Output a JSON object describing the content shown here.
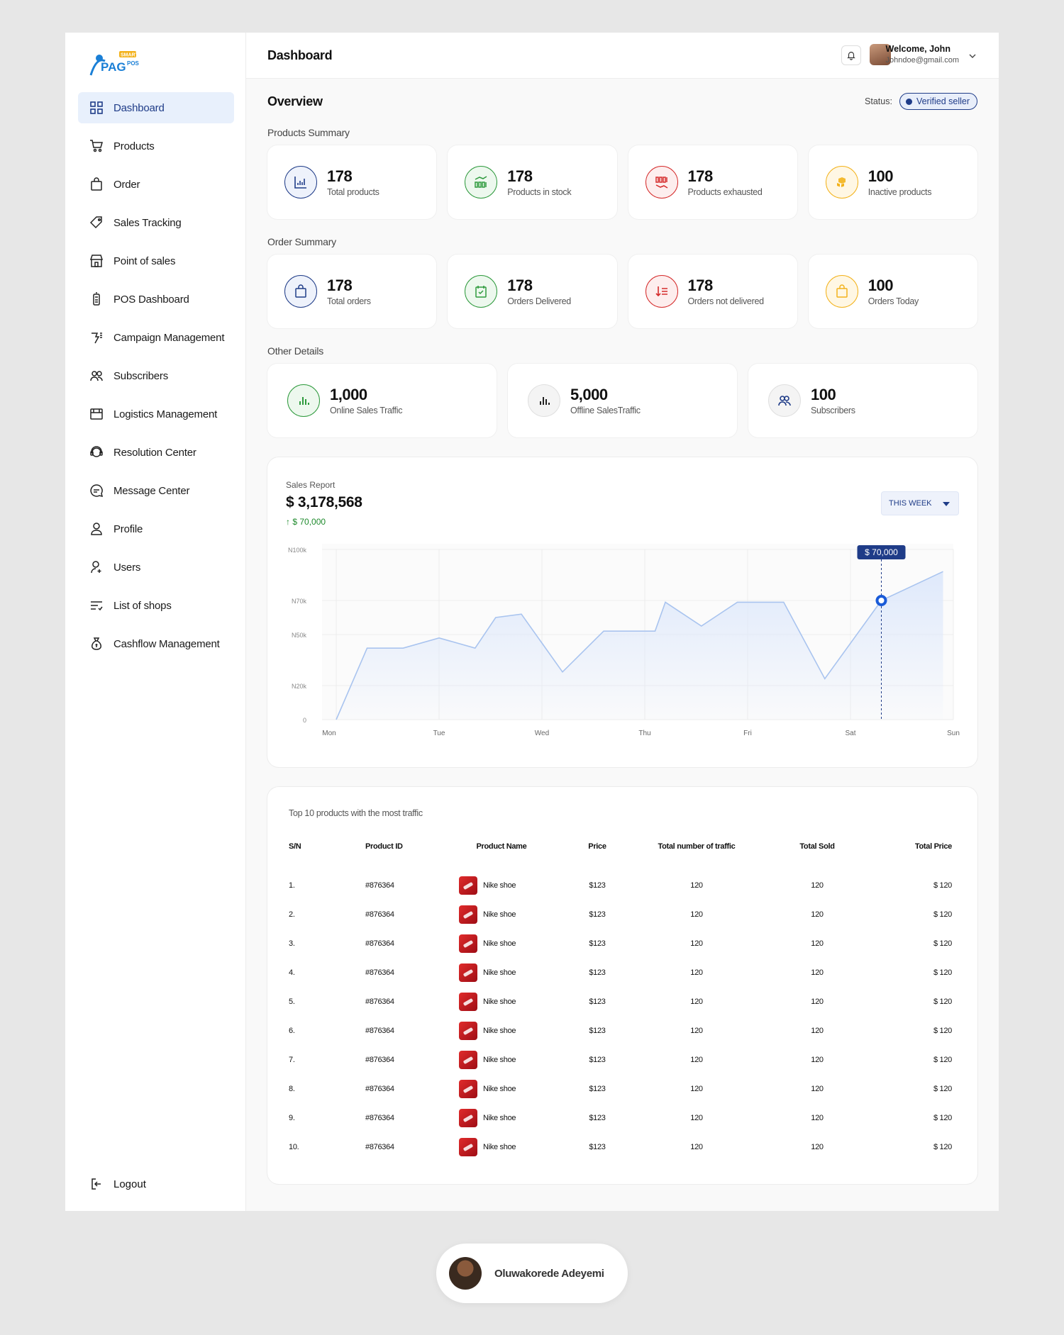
{
  "brand": {
    "logo_text": "PAG",
    "logo_badge": "SMART",
    "logo_sub": "POS"
  },
  "sidebar": {
    "items": [
      {
        "label": "Dashboard",
        "icon": "grid-icon",
        "active": true
      },
      {
        "label": "Products",
        "icon": "cart-icon"
      },
      {
        "label": "Order",
        "icon": "bag-icon"
      },
      {
        "label": "Sales Tracking",
        "icon": "tag-icon"
      },
      {
        "label": "Point of sales",
        "icon": "store-icon"
      },
      {
        "label": "POS Dashboard",
        "icon": "pos-terminal-icon"
      },
      {
        "label": "Campaign Management",
        "icon": "megaphone-icon"
      },
      {
        "label": "Subscribers",
        "icon": "people-icon"
      },
      {
        "label": "Logistics Management",
        "icon": "truck-icon"
      },
      {
        "label": "Resolution Center",
        "icon": "headset-icon"
      },
      {
        "label": "Message Center",
        "icon": "chat-icon"
      },
      {
        "label": "Profile",
        "icon": "user-icon"
      },
      {
        "label": "Users",
        "icon": "user-add-icon"
      },
      {
        "label": "List of shops",
        "icon": "list-icon"
      },
      {
        "label": "Cashflow Management",
        "icon": "money-bag-icon"
      }
    ],
    "logout": "Logout"
  },
  "header": {
    "title": "Dashboard",
    "welcome": "Welcome, John",
    "email": "Johndoe@gmail.com"
  },
  "overview": {
    "title": "Overview",
    "status_label": "Status:",
    "status_value": "Verified seller"
  },
  "products_summary": {
    "title": "Products Summary",
    "cards": [
      {
        "value": "178",
        "label": "Total products",
        "color": "#1f3c88",
        "icon": "bar-chart-icon"
      },
      {
        "value": "178",
        "label": "Products in stock",
        "color": "#2e9a3d",
        "icon": "stock-chart-icon"
      },
      {
        "value": "178",
        "label": "Products exhausted",
        "color": "#d52b2b",
        "icon": "decline-chart-icon"
      },
      {
        "value": "100",
        "label": "Inactive products",
        "color": "#f3b21b",
        "icon": "boxes-icon"
      }
    ]
  },
  "order_summary": {
    "title": "Order Summary",
    "cards": [
      {
        "value": "178",
        "label": "Total orders",
        "color": "#1f3c88",
        "icon": "bag-icon"
      },
      {
        "value": "178",
        "label": "Orders Delivered",
        "color": "#2e9a3d",
        "icon": "check-box-icon"
      },
      {
        "value": "178",
        "label": "Orders not delivered",
        "color": "#d52b2b",
        "icon": "sort-down-icon"
      },
      {
        "value": "100",
        "label": "Orders Today",
        "color": "#f3b21b",
        "icon": "bag-icon"
      }
    ]
  },
  "other_details": {
    "title": "Other Details",
    "cards": [
      {
        "value": "1,000",
        "label": "Online Sales Traffic",
        "color": "#2e9a3d",
        "icon": "bar-chart-icon"
      },
      {
        "value": "5,000",
        "label": "Offline SalesTraffic",
        "color": "#222222",
        "icon": "bar-chart-icon"
      },
      {
        "value": "100",
        "label": "Subscribers",
        "color": "#1f3c88",
        "icon": "people-icon"
      }
    ]
  },
  "sales_report": {
    "title": "Sales Report",
    "total": "$ 3,178,568",
    "change": "↑ $ 70,000",
    "period": "THIS WEEK",
    "tooltip": "$ 70,000"
  },
  "chart_data": {
    "type": "area",
    "x_labels": [
      "Mon",
      "Tue",
      "Wed",
      "Thu",
      "Fri",
      "Sat",
      "Sun"
    ],
    "y_ticks": [
      "0",
      "N20k",
      "N50k",
      "N70k",
      "N100k"
    ],
    "ylim": [
      0,
      100
    ],
    "y_tick_values": [
      0,
      20,
      50,
      70,
      100
    ],
    "grid": true,
    "accent_color": "#1a5bd8",
    "fill_color": "#dfe9fb",
    "line_color": "#a9c4ef",
    "points": [
      {
        "x": 0.0,
        "y": 0
      },
      {
        "x": 0.3,
        "y": 42
      },
      {
        "x": 0.65,
        "y": 42
      },
      {
        "x": 1.0,
        "y": 48
      },
      {
        "x": 1.35,
        "y": 42
      },
      {
        "x": 1.55,
        "y": 60
      },
      {
        "x": 1.8,
        "y": 62
      },
      {
        "x": 2.2,
        "y": 28
      },
      {
        "x": 2.6,
        "y": 52
      },
      {
        "x": 3.1,
        "y": 52
      },
      {
        "x": 3.2,
        "y": 69
      },
      {
        "x": 3.55,
        "y": 55
      },
      {
        "x": 3.9,
        "y": 69
      },
      {
        "x": 4.35,
        "y": 69
      },
      {
        "x": 4.75,
        "y": 24
      },
      {
        "x": 5.3,
        "y": 70
      },
      {
        "x": 5.9,
        "y": 87
      }
    ],
    "highlight": {
      "x": 5.3,
      "y": 70,
      "label": "$ 70,000"
    }
  },
  "top_products": {
    "title": "Top 10 products with the most traffic",
    "columns": [
      "S/N",
      "Product ID",
      "Product Name",
      "Price",
      "Total number of traffic",
      "Total Sold",
      "Total Price"
    ],
    "rows": [
      [
        "1.",
        "#876364",
        "Nike shoe",
        "$123",
        "120",
        "120",
        "$ 120"
      ],
      [
        "2.",
        "#876364",
        "Nike shoe",
        "$123",
        "120",
        "120",
        "$ 120"
      ],
      [
        "3.",
        "#876364",
        "Nike shoe",
        "$123",
        "120",
        "120",
        "$ 120"
      ],
      [
        "4.",
        "#876364",
        "Nike shoe",
        "$123",
        "120",
        "120",
        "$ 120"
      ],
      [
        "5.",
        "#876364",
        "Nike shoe",
        "$123",
        "120",
        "120",
        "$ 120"
      ],
      [
        "6.",
        "#876364",
        "Nike shoe",
        "$123",
        "120",
        "120",
        "$ 120"
      ],
      [
        "7.",
        "#876364",
        "Nike shoe",
        "$123",
        "120",
        "120",
        "$ 120"
      ],
      [
        "8.",
        "#876364",
        "Nike shoe",
        "$123",
        "120",
        "120",
        "$ 120"
      ],
      [
        "9.",
        "#876364",
        "Nike shoe",
        "$123",
        "120",
        "120",
        "$ 120"
      ],
      [
        "10.",
        "#876364",
        "Nike shoe",
        "$123",
        "120",
        "120",
        "$ 120"
      ]
    ]
  },
  "credit": {
    "name": "Oluwakorede Adeyemi"
  }
}
